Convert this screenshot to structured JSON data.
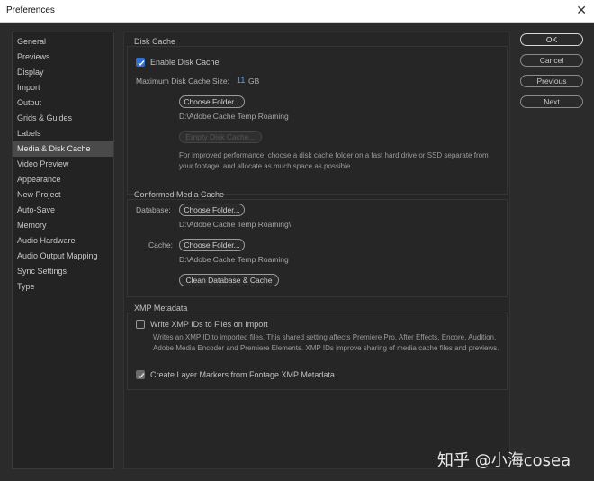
{
  "window": {
    "title": "Preferences",
    "close_glyph": "✕"
  },
  "sidebar": {
    "items": [
      {
        "label": "General"
      },
      {
        "label": "Previews"
      },
      {
        "label": "Display"
      },
      {
        "label": "Import"
      },
      {
        "label": "Output"
      },
      {
        "label": "Grids & Guides"
      },
      {
        "label": "Labels"
      },
      {
        "label": "Media & Disk Cache",
        "selected": true
      },
      {
        "label": "Video Preview"
      },
      {
        "label": "Appearance"
      },
      {
        "label": "New Project"
      },
      {
        "label": "Auto-Save"
      },
      {
        "label": "Memory"
      },
      {
        "label": "Audio Hardware"
      },
      {
        "label": "Audio Output Mapping"
      },
      {
        "label": "Sync Settings"
      },
      {
        "label": "Type"
      }
    ]
  },
  "disk_cache": {
    "title": "Disk Cache",
    "enable_label": "Enable Disk Cache",
    "enable_checked": true,
    "max_size_label": "Maximum Disk Cache Size:",
    "max_size_value": "11",
    "max_size_unit": "GB",
    "choose_folder_label": "Choose Folder...",
    "folder_path": "D:\\Adobe Cache Temp Roaming",
    "empty_cache_label": "Empty Disk Cache...",
    "hint": "For improved performance, choose a disk cache folder on a fast hard drive or SSD separate from your footage, and allocate as much space as possible."
  },
  "conformed": {
    "title": "Conformed Media Cache",
    "database_label": "Database:",
    "database_button": "Choose Folder...",
    "database_path": "D:\\Adobe Cache Temp Roaming\\",
    "cache_label": "Cache:",
    "cache_button": "Choose Folder...",
    "cache_path": "D:\\Adobe Cache Temp Roaming",
    "clean_button": "Clean Database & Cache"
  },
  "xmp": {
    "title": "XMP Metadata",
    "write_ids_label": "Write XMP IDs to Files on Import",
    "write_ids_checked": false,
    "write_ids_desc": "Writes an XMP ID to imported files. This shared setting affects Premiere Pro, After Effects, Encore, Audition, Adobe Media Encoder and Premiere Elements. XMP IDs improve sharing of media cache files and previews.",
    "layer_markers_label": "Create Layer Markers from Footage XMP Metadata",
    "layer_markers_checked": true
  },
  "dialog_buttons": {
    "ok": "OK",
    "cancel": "Cancel",
    "previous": "Previous",
    "next": "Next"
  },
  "watermark": "知乎 @小海cosea",
  "colors": {
    "accent": "#2d6fd2",
    "size_value": "#5aa0f0",
    "background": "#2b2b2b"
  }
}
